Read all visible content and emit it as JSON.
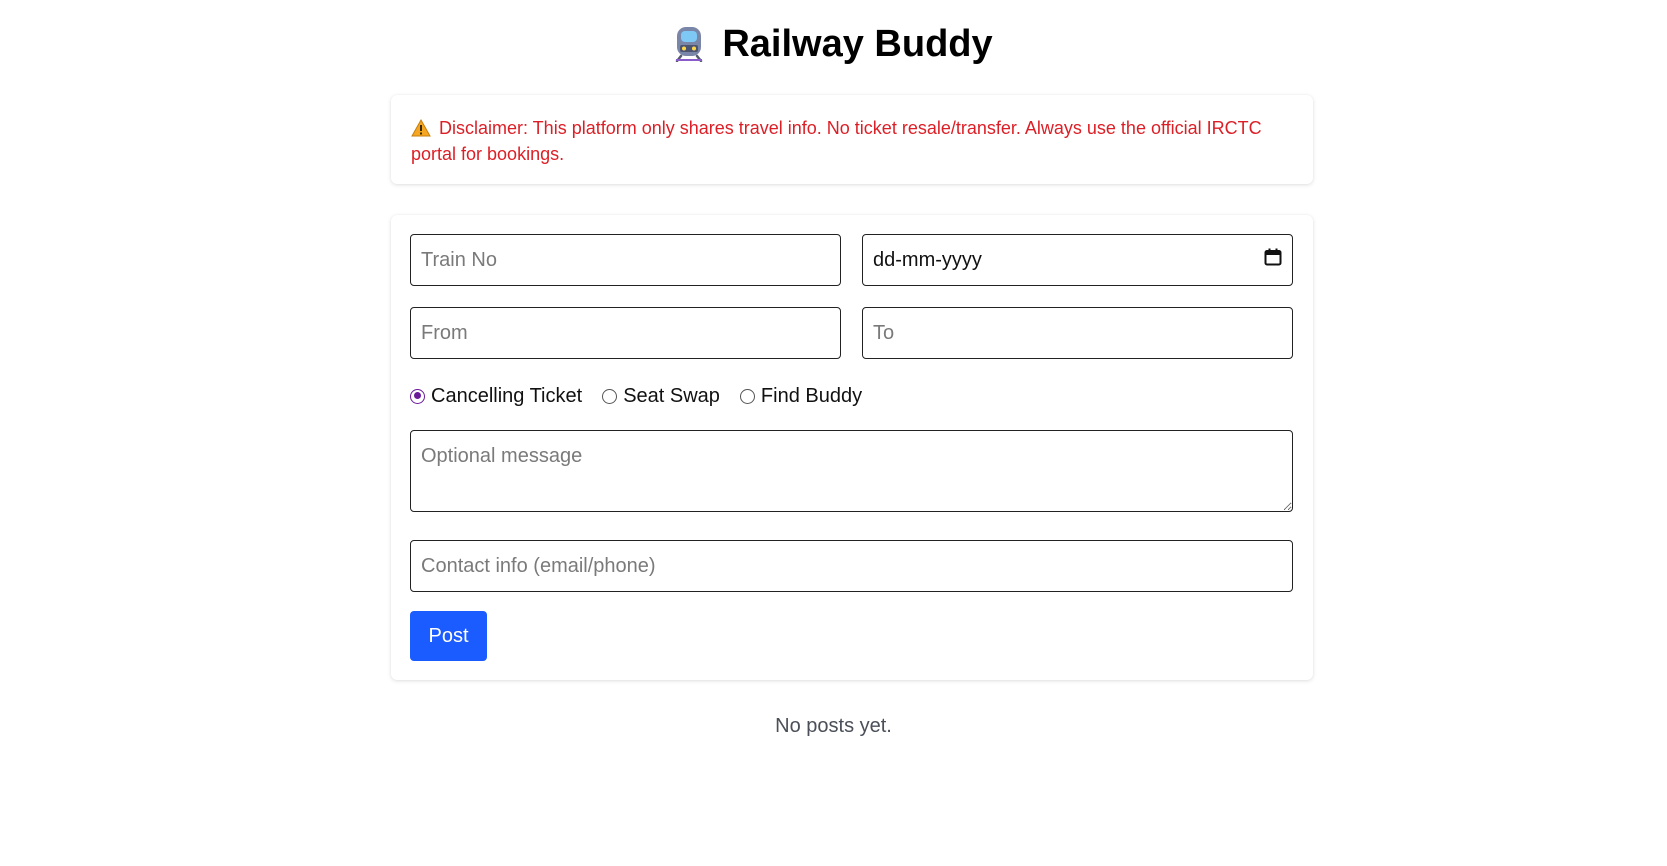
{
  "header": {
    "title": "Railway Buddy",
    "icon": "train-icon"
  },
  "disclaimer": {
    "icon": "warning-icon",
    "text": "Disclaimer: This platform only shares travel info. No ticket resale/transfer. Always use the official IRCTC portal for bookings.",
    "color": "#dc1f26"
  },
  "form": {
    "train_no": {
      "placeholder": "Train No",
      "value": ""
    },
    "date": {
      "display": "dd-mm-yyyy",
      "icon": "calendar-icon"
    },
    "from": {
      "placeholder": "From",
      "value": ""
    },
    "to": {
      "placeholder": "To",
      "value": ""
    },
    "post_type": {
      "options": [
        "Cancelling Ticket",
        "Seat Swap",
        "Find Buddy"
      ],
      "selected": "Cancelling Ticket"
    },
    "message": {
      "placeholder": "Optional message",
      "value": ""
    },
    "contact": {
      "placeholder": "Contact info (email/phone)",
      "value": ""
    },
    "submit_label": "Post"
  },
  "posts": {
    "empty_text": "No posts yet."
  },
  "colors": {
    "accent": "#1a5cff",
    "radio_checked": "#6a1b9a"
  }
}
